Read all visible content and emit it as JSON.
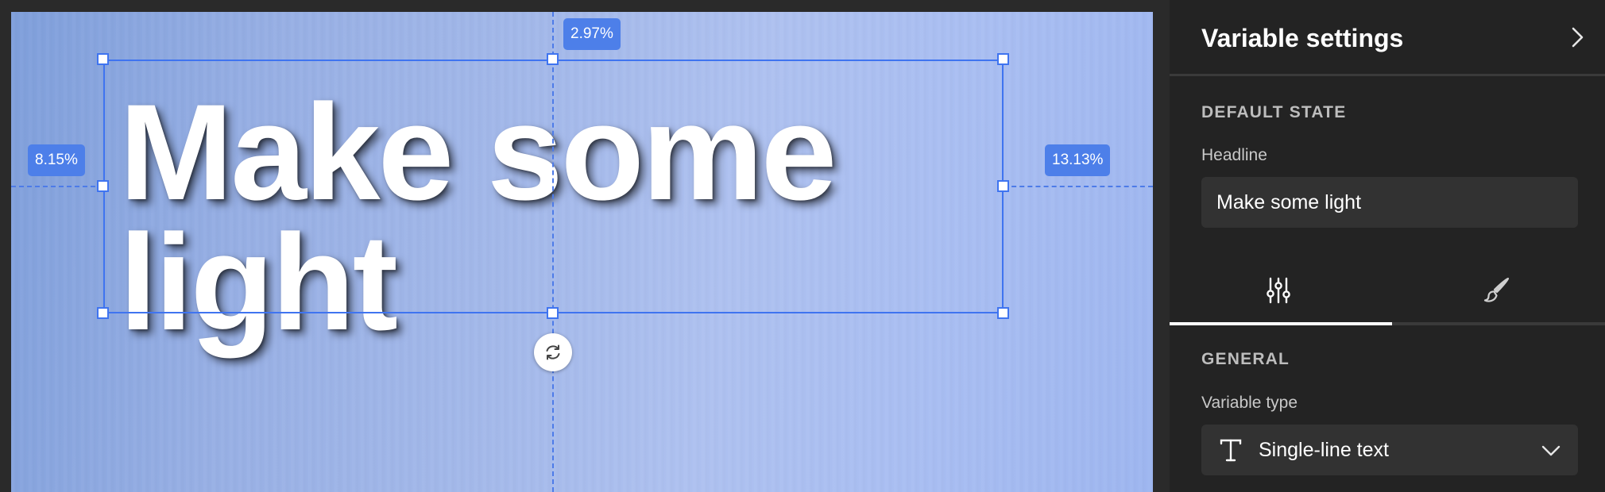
{
  "canvas": {
    "headline_text": "Make some light",
    "headline_line1": "Make some",
    "headline_line2": "light",
    "measure_top": "2.97%",
    "measure_left": "8.15%",
    "measure_right": "13.13%",
    "rotate_icon": "rotate-icon",
    "colors": {
      "selection": "#3f74f0",
      "measure_badge": "#4d7fe9",
      "text": "#ffffff"
    }
  },
  "panel": {
    "title": "Variable settings",
    "collapse_icon": "chevron-right-icon",
    "default_state_label": "DEFAULT STATE",
    "headline_field_label": "Headline",
    "headline_field_value": "Make some light",
    "tabs": [
      {
        "icon": "sliders-icon",
        "selected": true
      },
      {
        "icon": "brush-icon",
        "selected": false
      }
    ],
    "general_label": "GENERAL",
    "variable_type_label": "Variable type",
    "variable_type_value": "Single-line text",
    "variable_type_icon": "text-type-icon",
    "dropdown_icon": "chevron-down-icon",
    "colors": {
      "background": "#232323",
      "field_bg": "#323232",
      "tab_indicator": "#ffffff"
    }
  }
}
